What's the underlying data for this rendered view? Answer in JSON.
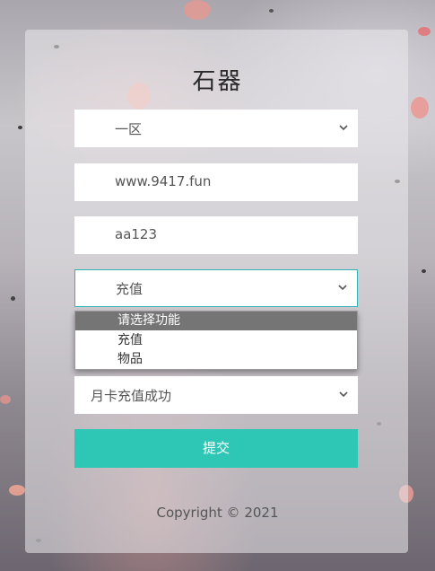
{
  "title": "石器",
  "server_select": {
    "value": "一区"
  },
  "account_field": {
    "value": "www.9417.fun"
  },
  "password_field": {
    "value": "aa123"
  },
  "function_select": {
    "value": "充值",
    "options": [
      "请选择功能",
      "充值",
      "物品"
    ]
  },
  "item_select": {
    "value": "月卡充值成功"
  },
  "submit": {
    "label": "提交"
  },
  "footer": {
    "copyright": "Copyright © 2021"
  },
  "colors": {
    "accent": "#2ec7b6",
    "focus_border": "#33b3b0",
    "option_highlight": "#757575"
  }
}
